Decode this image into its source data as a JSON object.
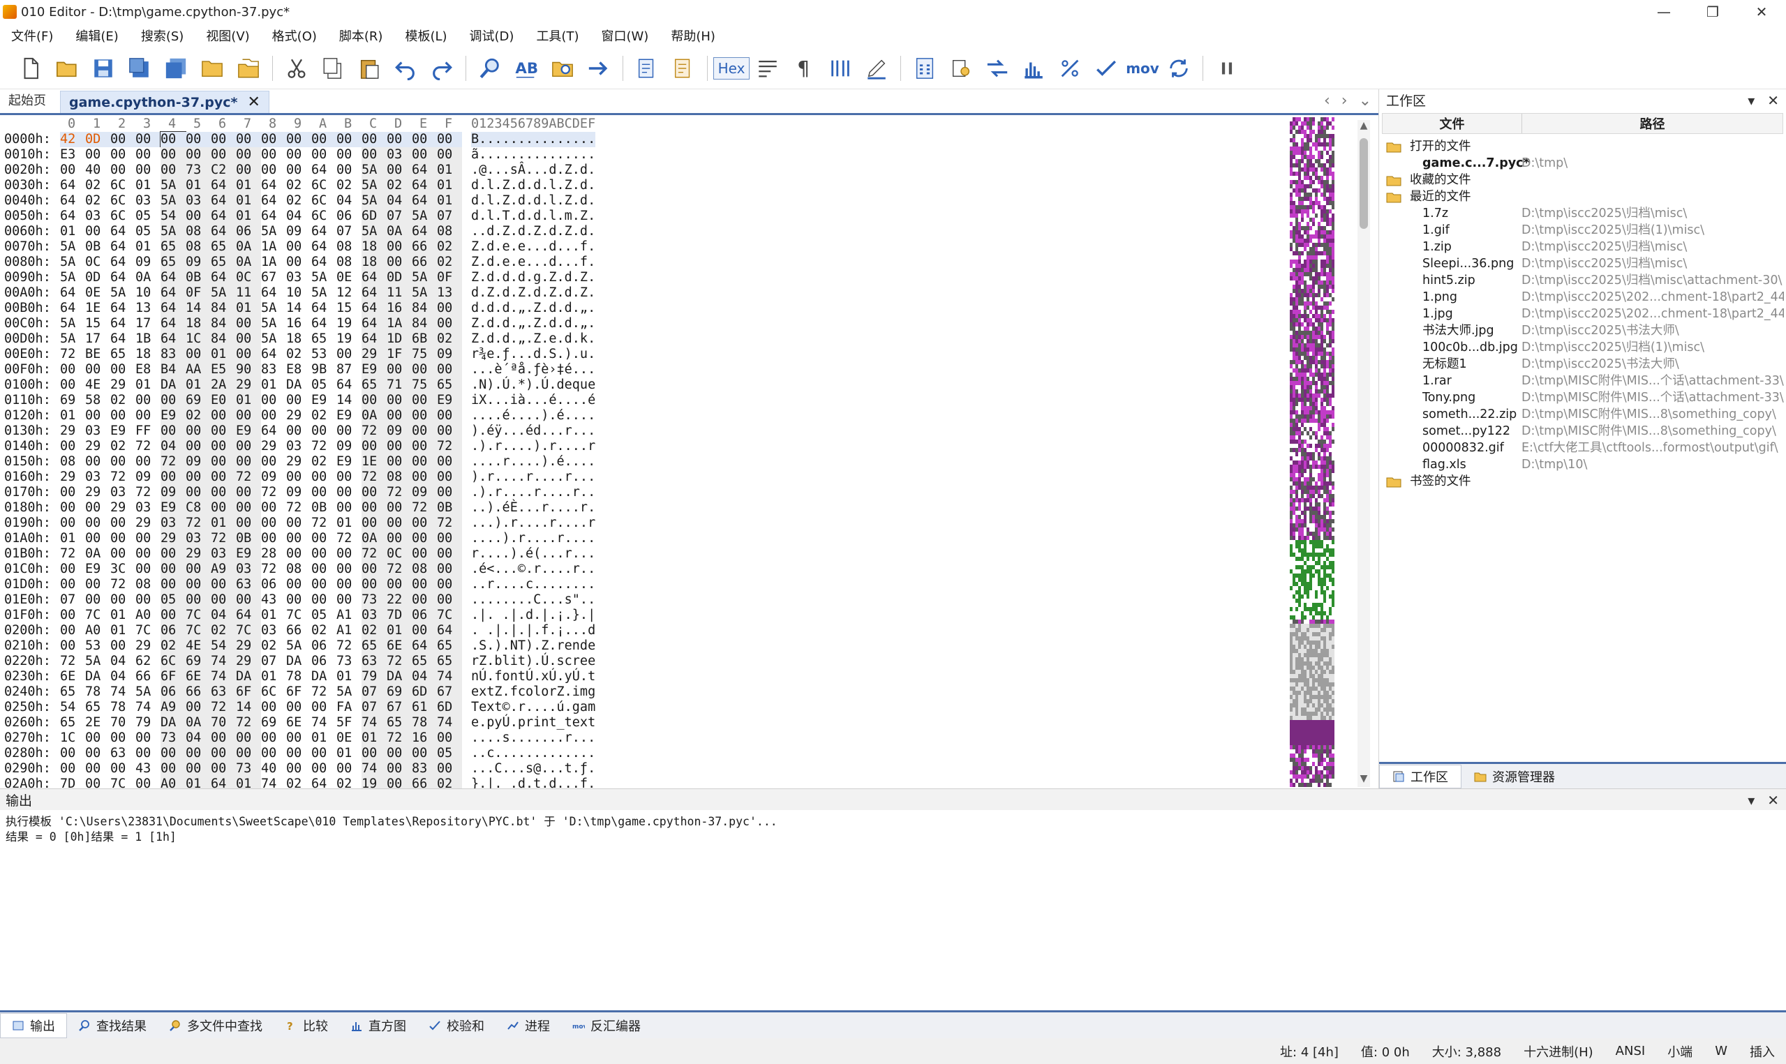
{
  "window": {
    "title": "010 Editor - D:\\tmp\\game.cpython-37.pyc*",
    "minimize": "—",
    "restore": "❐",
    "close": "✕"
  },
  "menu": [
    "文件(F)",
    "编辑(E)",
    "搜索(S)",
    "视图(V)",
    "格式(O)",
    "脚本(R)",
    "模板(L)",
    "调试(D)",
    "工具(T)",
    "窗口(W)",
    "帮助(H)"
  ],
  "toolbar": {
    "hex_label": "Hex",
    "mov_label": "mov",
    "icons": [
      "new-file-icon",
      "open-file-icon",
      "save-icon",
      "save-as-icon",
      "save-all-icon",
      "open-folder-icon",
      "workspace-icon",
      "cut-icon",
      "copy-icon",
      "paste-icon",
      "undo-icon",
      "redo-icon",
      "find-icon",
      "replace-icon",
      "find-in-files-icon",
      "goto-icon",
      "run-script-icon",
      "run-template-icon",
      "hex-mode-icon",
      "text-wrap-icon",
      "pilcrow-icon",
      "columns-icon",
      "highlight-icon",
      "calculator-icon",
      "inspector-icon",
      "compare-icon",
      "histogram-icon",
      "percent-icon",
      "checksum-icon",
      "disassembler-icon",
      "base-converter-icon",
      "pause-icon"
    ]
  },
  "tabs": {
    "start": "起始页",
    "active": "game.cpython-37.pyc*",
    "close": "✕",
    "nav_prev": "‹",
    "nav_next": "›",
    "nav_list": "⌄"
  },
  "hex": {
    "col_headers": [
      "0",
      "1",
      "2",
      "3",
      "4",
      "5",
      "6",
      "7",
      "8",
      "9",
      "A",
      "B",
      "C",
      "D",
      "E",
      "F"
    ],
    "ascii_header": "0123456789ABCDEF",
    "rows": [
      {
        "addr": "0000h:",
        "bytes": [
          "42",
          "0D",
          "00",
          "00",
          "00",
          "00",
          "00",
          "00",
          "00",
          "00",
          "00",
          "00",
          "00",
          "00",
          "00",
          "00"
        ],
        "ascii": "B..............."
      },
      {
        "addr": "0010h:",
        "bytes": [
          "E3",
          "00",
          "00",
          "00",
          "00",
          "00",
          "00",
          "00",
          "00",
          "00",
          "00",
          "00",
          "00",
          "03",
          "00",
          "00"
        ],
        "ascii": "ã..............."
      },
      {
        "addr": "0020h:",
        "bytes": [
          "00",
          "40",
          "00",
          "00",
          "00",
          "73",
          "C2",
          "00",
          "00",
          "00",
          "64",
          "00",
          "5A",
          "00",
          "64",
          "01"
        ],
        "ascii": ".@...sÂ...d.Z.d."
      },
      {
        "addr": "0030h:",
        "bytes": [
          "64",
          "02",
          "6C",
          "01",
          "5A",
          "01",
          "64",
          "01",
          "64",
          "02",
          "6C",
          "02",
          "5A",
          "02",
          "64",
          "01"
        ],
        "ascii": "d.l.Z.d.d.l.Z.d."
      },
      {
        "addr": "0040h:",
        "bytes": [
          "64",
          "02",
          "6C",
          "03",
          "5A",
          "03",
          "64",
          "01",
          "64",
          "02",
          "6C",
          "04",
          "5A",
          "04",
          "64",
          "01"
        ],
        "ascii": "d.l.Z.d.d.l.Z.d."
      },
      {
        "addr": "0050h:",
        "bytes": [
          "64",
          "03",
          "6C",
          "05",
          "54",
          "00",
          "64",
          "01",
          "64",
          "04",
          "6C",
          "06",
          "6D",
          "07",
          "5A",
          "07"
        ],
        "ascii": "d.l.T.d.d.l.m.Z."
      },
      {
        "addr": "0060h:",
        "bytes": [
          "01",
          "00",
          "64",
          "05",
          "5A",
          "08",
          "64",
          "06",
          "5A",
          "09",
          "64",
          "07",
          "5A",
          "0A",
          "64",
          "08"
        ],
        "ascii": "..d.Z.d.Z.d.Z.d."
      },
      {
        "addr": "0070h:",
        "bytes": [
          "5A",
          "0B",
          "64",
          "01",
          "65",
          "08",
          "65",
          "0A",
          "1A",
          "00",
          "64",
          "08",
          "18",
          "00",
          "66",
          "02"
        ],
        "ascii": "Z.d.e.e...d...f."
      },
      {
        "addr": "0080h:",
        "bytes": [
          "5A",
          "0C",
          "64",
          "09",
          "65",
          "09",
          "65",
          "0A",
          "1A",
          "00",
          "64",
          "08",
          "18",
          "00",
          "66",
          "02"
        ],
        "ascii": "Z.d.e.e...d...f."
      },
      {
        "addr": "0090h:",
        "bytes": [
          "5A",
          "0D",
          "64",
          "0A",
          "64",
          "0B",
          "64",
          "0C",
          "67",
          "03",
          "5A",
          "0E",
          "64",
          "0D",
          "5A",
          "0F"
        ],
        "ascii": "Z.d.d.d.g.Z.d.Z."
      },
      {
        "addr": "00A0h:",
        "bytes": [
          "64",
          "0E",
          "5A",
          "10",
          "64",
          "0F",
          "5A",
          "11",
          "64",
          "10",
          "5A",
          "12",
          "64",
          "11",
          "5A",
          "13"
        ],
        "ascii": "d.Z.d.Z.d.Z.d.Z."
      },
      {
        "addr": "00B0h:",
        "bytes": [
          "64",
          "1E",
          "64",
          "13",
          "64",
          "14",
          "84",
          "01",
          "5A",
          "14",
          "64",
          "15",
          "64",
          "16",
          "84",
          "00"
        ],
        "ascii": "d.d.d.„.Z.d.d.„."
      },
      {
        "addr": "00C0h:",
        "bytes": [
          "5A",
          "15",
          "64",
          "17",
          "64",
          "18",
          "84",
          "00",
          "5A",
          "16",
          "64",
          "19",
          "64",
          "1A",
          "84",
          "00"
        ],
        "ascii": "Z.d.d.„.Z.d.d.„."
      },
      {
        "addr": "00D0h:",
        "bytes": [
          "5A",
          "17",
          "64",
          "1B",
          "64",
          "1C",
          "84",
          "00",
          "5A",
          "18",
          "65",
          "19",
          "64",
          "1D",
          "6B",
          "02"
        ],
        "ascii": "Z.d.d.„.Z.e.d.k."
      },
      {
        "addr": "00E0h:",
        "bytes": [
          "72",
          "BE",
          "65",
          "18",
          "83",
          "00",
          "01",
          "00",
          "64",
          "02",
          "53",
          "00",
          "29",
          "1F",
          "75",
          "09"
        ],
        "ascii": "r¾e.ƒ...d.S.).u."
      },
      {
        "addr": "00F0h:",
        "bytes": [
          "00",
          "00",
          "00",
          "E8",
          "B4",
          "AA",
          "E5",
          "90",
          "83",
          "E8",
          "9B",
          "87",
          "E9",
          "00",
          "00",
          "00"
        ],
        "ascii": "...è´ªå.ƒè›‡é..."
      },
      {
        "addr": "0100h:",
        "bytes": [
          "00",
          "4E",
          "29",
          "01",
          "DA",
          "01",
          "2A",
          "29",
          "01",
          "DA",
          "05",
          "64",
          "65",
          "71",
          "75",
          "65"
        ],
        "ascii": ".N).Ú.*).Ú.deque"
      },
      {
        "addr": "0110h:",
        "bytes": [
          "69",
          "58",
          "02",
          "00",
          "00",
          "69",
          "E0",
          "01",
          "00",
          "00",
          "E9",
          "14",
          "00",
          "00",
          "00",
          "E9"
        ],
        "ascii": "iX...ià...é....é"
      },
      {
        "addr": "0120h:",
        "bytes": [
          "01",
          "00",
          "00",
          "00",
          "E9",
          "02",
          "00",
          "00",
          "00",
          "29",
          "02",
          "E9",
          "0A",
          "00",
          "00",
          "00"
        ],
        "ascii": "....é....).é...."
      },
      {
        "addr": "0130h:",
        "bytes": [
          "29",
          "03",
          "E9",
          "FF",
          "00",
          "00",
          "00",
          "E9",
          "64",
          "00",
          "00",
          "00",
          "72",
          "09",
          "00",
          "00"
        ],
        "ascii": ").éÿ...éd...r..."
      },
      {
        "addr": "0140h:",
        "bytes": [
          "00",
          "29",
          "02",
          "72",
          "04",
          "00",
          "00",
          "00",
          "29",
          "03",
          "72",
          "09",
          "00",
          "00",
          "00",
          "72"
        ],
        "ascii": ".).r....).r....r"
      },
      {
        "addr": "0150h:",
        "bytes": [
          "08",
          "00",
          "00",
          "00",
          "72",
          "09",
          "00",
          "00",
          "00",
          "29",
          "02",
          "E9",
          "1E",
          "00",
          "00",
          "00"
        ],
        "ascii": "....r....).é...."
      },
      {
        "addr": "0160h:",
        "bytes": [
          "29",
          "03",
          "72",
          "09",
          "00",
          "00",
          "00",
          "72",
          "09",
          "00",
          "00",
          "00",
          "72",
          "08",
          "00",
          "00"
        ],
        "ascii": ").r....r....r..."
      },
      {
        "addr": "0170h:",
        "bytes": [
          "00",
          "29",
          "03",
          "72",
          "09",
          "00",
          "00",
          "00",
          "72",
          "09",
          "00",
          "00",
          "00",
          "72",
          "09",
          "00"
        ],
        "ascii": ".).r....r....r.."
      },
      {
        "addr": "0180h:",
        "bytes": [
          "00",
          "00",
          "29",
          "03",
          "E9",
          "C8",
          "00",
          "00",
          "00",
          "72",
          "0B",
          "00",
          "00",
          "00",
          "72",
          "0B"
        ],
        "ascii": "..).éÈ...r....r."
      },
      {
        "addr": "0190h:",
        "bytes": [
          "00",
          "00",
          "00",
          "29",
          "03",
          "72",
          "01",
          "00",
          "00",
          "00",
          "72",
          "01",
          "00",
          "00",
          "00",
          "72"
        ],
        "ascii": "...).r....r....r"
      },
      {
        "addr": "01A0h:",
        "bytes": [
          "01",
          "00",
          "00",
          "00",
          "29",
          "03",
          "72",
          "0B",
          "00",
          "00",
          "00",
          "72",
          "0A",
          "00",
          "00",
          "00"
        ],
        "ascii": "....).r....r...."
      },
      {
        "addr": "01B0h:",
        "bytes": [
          "72",
          "0A",
          "00",
          "00",
          "00",
          "29",
          "03",
          "E9",
          "28",
          "00",
          "00",
          "00",
          "72",
          "0C",
          "00",
          "00"
        ],
        "ascii": "r....).é(...r..."
      },
      {
        "addr": "01C0h:",
        "bytes": [
          "00",
          "E9",
          "3C",
          "00",
          "00",
          "00",
          "A9",
          "03",
          "72",
          "08",
          "00",
          "00",
          "00",
          "72",
          "08",
          "00"
        ],
        "ascii": ".é<...©.r....r.."
      },
      {
        "addr": "01D0h:",
        "bytes": [
          "00",
          "00",
          "72",
          "08",
          "00",
          "00",
          "00",
          "63",
          "06",
          "00",
          "00",
          "00",
          "00",
          "00",
          "00",
          "00"
        ],
        "ascii": "..r....c........"
      },
      {
        "addr": "01E0h:",
        "bytes": [
          "07",
          "00",
          "00",
          "00",
          "05",
          "00",
          "00",
          "00",
          "43",
          "00",
          "00",
          "00",
          "73",
          "22",
          "00",
          "00"
        ],
        "ascii": "........C...s\".."
      },
      {
        "addr": "01F0h:",
        "bytes": [
          "00",
          "7C",
          "01",
          "A0",
          "00",
          "7C",
          "04",
          "64",
          "01",
          "7C",
          "05",
          "A1",
          "03",
          "7D",
          "06",
          "7C"
        ],
        "ascii": ".|. .|.d.|.¡.}.|"
      },
      {
        "addr": "0200h:",
        "bytes": [
          "00",
          "A0",
          "01",
          "7C",
          "06",
          "7C",
          "02",
          "7C",
          "03",
          "66",
          "02",
          "A1",
          "02",
          "01",
          "00",
          "64"
        ],
        "ascii": ". .|.|.|.f.¡...d"
      },
      {
        "addr": "0210h:",
        "bytes": [
          "00",
          "53",
          "00",
          "29",
          "02",
          "4E",
          "54",
          "29",
          "02",
          "5A",
          "06",
          "72",
          "65",
          "6E",
          "64",
          "65"
        ],
        "ascii": ".S.).NT).Z.rende"
      },
      {
        "addr": "0220h:",
        "bytes": [
          "72",
          "5A",
          "04",
          "62",
          "6C",
          "69",
          "74",
          "29",
          "07",
          "DA",
          "06",
          "73",
          "63",
          "72",
          "65",
          "65"
        ],
        "ascii": "rZ.blit).Ú.scree"
      },
      {
        "addr": "0230h:",
        "bytes": [
          "6E",
          "DA",
          "04",
          "66",
          "6F",
          "6E",
          "74",
          "DA",
          "01",
          "78",
          "DA",
          "01",
          "79",
          "DA",
          "04",
          "74"
        ],
        "ascii": "nÚ.fontÚ.xÚ.yÚ.t"
      },
      {
        "addr": "0240h:",
        "bytes": [
          "65",
          "78",
          "74",
          "5A",
          "06",
          "66",
          "63",
          "6F",
          "6C",
          "6F",
          "72",
          "5A",
          "07",
          "69",
          "6D",
          "67"
        ],
        "ascii": "extZ.fcolorZ.img"
      },
      {
        "addr": "0250h:",
        "bytes": [
          "54",
          "65",
          "78",
          "74",
          "A9",
          "00",
          "72",
          "14",
          "00",
          "00",
          "00",
          "FA",
          "07",
          "67",
          "61",
          "6D"
        ],
        "ascii": "Text©.r....ú.gam"
      },
      {
        "addr": "0260h:",
        "bytes": [
          "65",
          "2E",
          "70",
          "79",
          "DA",
          "0A",
          "70",
          "72",
          "69",
          "6E",
          "74",
          "5F",
          "74",
          "65",
          "78",
          "74"
        ],
        "ascii": "e.pyÚ.print_text"
      },
      {
        "addr": "0270h:",
        "bytes": [
          "1C",
          "00",
          "00",
          "00",
          "73",
          "04",
          "00",
          "00",
          "00",
          "00",
          "01",
          "0E",
          "01",
          "72",
          "16",
          "00"
        ],
        "ascii": "....s.......r..."
      },
      {
        "addr": "0280h:",
        "bytes": [
          "00",
          "00",
          "63",
          "00",
          "00",
          "00",
          "00",
          "00",
          "00",
          "00",
          "00",
          "01",
          "00",
          "00",
          "00",
          "05"
        ],
        "ascii": "..c............."
      },
      {
        "addr": "0290h:",
        "bytes": [
          "00",
          "00",
          "00",
          "43",
          "00",
          "00",
          "00",
          "73",
          "40",
          "00",
          "00",
          "00",
          "74",
          "00",
          "83",
          "00"
        ],
        "ascii": "...C...s@...t.ƒ."
      },
      {
        "addr": "02A0h:",
        "bytes": [
          "7D",
          "00",
          "7C",
          "00",
          "A0",
          "01",
          "64",
          "01",
          "74",
          "02",
          "64",
          "02",
          "19",
          "00",
          "66",
          "02"
        ],
        "ascii": "}.|. .d.t.d...f."
      }
    ]
  },
  "workspace": {
    "title": "工作区",
    "col_file": "文件",
    "col_path": "路径",
    "open_files_label": "打开的文件",
    "favorites_label": "收藏的文件",
    "recent_label": "最近的文件",
    "bookmarks_label": "书签的文件",
    "open_files": [
      {
        "name": "game.c...7.pyc*",
        "path": "D:\\tmp\\"
      }
    ],
    "recent_files": [
      {
        "name": "1.7z",
        "path": "D:\\tmp\\iscc2025\\归档\\misc\\"
      },
      {
        "name": "1.gif",
        "path": "D:\\tmp\\iscc2025\\归档(1)\\misc\\"
      },
      {
        "name": "1.zip",
        "path": "D:\\tmp\\iscc2025\\归档\\misc\\"
      },
      {
        "name": "Sleepi...36.png",
        "path": "D:\\tmp\\iscc2025\\归档\\misc\\"
      },
      {
        "name": "hint5.zip",
        "path": "D:\\tmp\\iscc2025\\归档\\misc\\attachment-30\\"
      },
      {
        "name": "1.png",
        "path": "D:\\tmp\\iscc2025\\202...chment-18\\part2_44\\"
      },
      {
        "name": "1.jpg",
        "path": "D:\\tmp\\iscc2025\\202...chment-18\\part2_44\\"
      },
      {
        "name": "书法大师.jpg",
        "path": "D:\\tmp\\iscc2025\\书法大师\\"
      },
      {
        "name": "100c0b...db.jpg",
        "path": "D:\\tmp\\iscc2025\\归档(1)\\misc\\"
      },
      {
        "name": "无标题1",
        "path": "D:\\tmp\\iscc2025\\书法大师\\"
      },
      {
        "name": "1.rar",
        "path": "D:\\tmp\\MISC附件\\MIS...个话\\attachment-33\\"
      },
      {
        "name": "Tony.png",
        "path": "D:\\tmp\\MISC附件\\MIS...个话\\attachment-33\\"
      },
      {
        "name": "someth...22.zip",
        "path": "D:\\tmp\\MISC附件\\MIS...8\\something_copy\\"
      },
      {
        "name": "somet...py122",
        "path": "D:\\tmp\\MISC附件\\MIS...8\\something_copy\\"
      },
      {
        "name": "00000832.gif",
        "path": "E:\\ctf大佬工具\\ctftools...formost\\output\\gif\\"
      },
      {
        "name": "flag.xls",
        "path": "D:\\tmp\\10\\"
      }
    ],
    "tab_workspace": "工作区",
    "tab_explorer": "资源管理器"
  },
  "output": {
    "title": "输出",
    "lines": [
      "执行模板 'C:\\Users\\23831\\Documents\\SweetScape\\010 Templates\\Repository\\PYC.bt' 于 'D:\\tmp\\game.cpython-37.pyc'...",
      "结果 = 0 [0h]结果 = 1 [1h]"
    ]
  },
  "bottom_tabs": [
    "输出",
    "查找结果",
    "多文件中查找",
    "比较",
    "直方图",
    "校验和",
    "进程",
    "反汇编器"
  ],
  "status": {
    "address": "址: 4 [4h]",
    "value": "值: 0 0h",
    "size": "大小: 3,888",
    "mode": "十六进制(H)",
    "encoding": "ANSI",
    "endian": "小端",
    "write": "W",
    "insert": "插入"
  },
  "colors": {
    "accent": "#4a6ea9",
    "selected_byte": "#e05a00",
    "tab_active_bg": "#dfe9f8",
    "path_gray": "#8a8a8a"
  }
}
